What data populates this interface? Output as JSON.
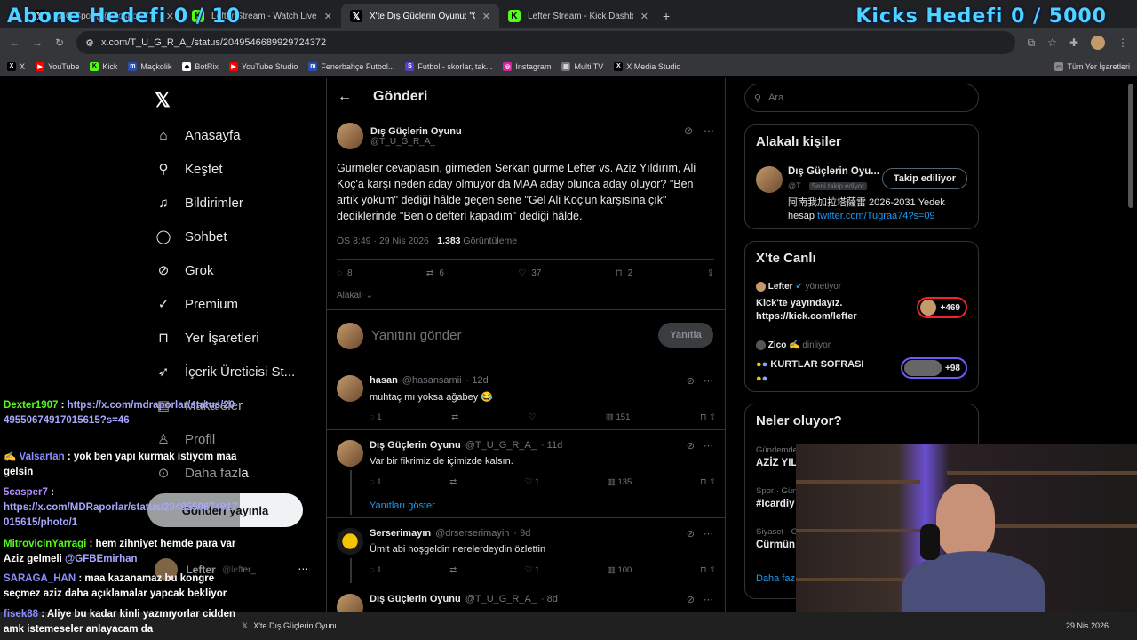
{
  "browser": {
    "tabs": [
      {
        "title": "NEO Spor (@neospor) / X",
        "icon": "x-logo-icon",
        "active": false
      },
      {
        "title": "Lefter Stream - Watch Live on Kick",
        "icon": "kick-icon",
        "active": false
      },
      {
        "title": "X'te Dış Güçlerin Oyunu: \"Gurme",
        "icon": "x-logo-icon",
        "active": true
      },
      {
        "title": "Lefter Stream - Kick Dashboard",
        "icon": "kick-icon",
        "active": false
      }
    ],
    "url": "x.com/T_U_G_R_A_/status/2049546689929724372",
    "bookmarks": [
      {
        "label": "X",
        "icon": "x-logo-icon"
      },
      {
        "label": "YouTube",
        "icon": "youtube-icon"
      },
      {
        "label": "Kick",
        "icon": "kick-icon"
      },
      {
        "label": "Maçkolik",
        "icon": "mackolik-icon"
      },
      {
        "label": "BotRix",
        "icon": "botrix-icon"
      },
      {
        "label": "YouTube Studio",
        "icon": "youtube-icon"
      },
      {
        "label": "Fenerbahçe Futbol...",
        "icon": "folder-m-icon"
      },
      {
        "label": "Futbol - skorlar, tak...",
        "icon": "flashscore-icon"
      },
      {
        "label": "Instagram",
        "icon": "instagram-icon"
      },
      {
        "label": "Multi TV",
        "icon": "page-icon"
      },
      {
        "label": "X Media Studio",
        "icon": "x-logo-icon"
      }
    ],
    "all_bookmarks": "Tüm Yer İşaretleri"
  },
  "overlay": {
    "left": "Abone Hedefi 0 / 10",
    "right": "Kicks Hedefi 0 / 5000"
  },
  "nav": {
    "items": [
      {
        "label": "Anasayfa",
        "icon": "home-icon"
      },
      {
        "label": "Keşfet",
        "icon": "search-icon"
      },
      {
        "label": "Bildirimler",
        "icon": "bell-icon"
      },
      {
        "label": "Sohbet",
        "icon": "chat-icon"
      },
      {
        "label": "Grok",
        "icon": "grok-icon"
      },
      {
        "label": "Premium",
        "icon": "premium-icon"
      },
      {
        "label": "Yer İşaretleri",
        "icon": "bookmark-icon"
      },
      {
        "label": "İçerik Üreticisi St...",
        "icon": "rocket-icon"
      },
      {
        "label": "Makaleler",
        "icon": "article-icon"
      },
      {
        "label": "Profil",
        "icon": "person-icon"
      },
      {
        "label": "Daha fazla",
        "icon": "more-circle-icon"
      }
    ],
    "post_button": "Gönderi yayınla",
    "profile_name": "Lefter",
    "profile_handle": "@lefter_"
  },
  "post": {
    "header": "Gönderi",
    "author_name": "Dış Güçlerin Oyunu",
    "author_handle": "@T_U_G_R_A_",
    "text": "Gurmeler cevaplasın, girmeden Serkan gurme Lefter vs. Aziz Yıldırım, Ali Koç'a karşı neden aday olmuyor da MAA aday olunca aday oluyor? \"Ben artık yokum\" dediği hâlde geçen sene \"Gel Ali Koç'un karşısına çık\" dediklerinde \"Ben o defteri kapadım\" dediği hâlde.",
    "time": "ÖS 8:49 · 29 Nis 2026 · ",
    "views": "1.383",
    "views_label": " Görüntüleme",
    "replies": "8",
    "reposts": "6",
    "likes": "37",
    "bookmarks": "2",
    "related": "Alakalı",
    "reply_placeholder": "Yanıtını gönder",
    "reply_button": "Yanıtla"
  },
  "comments": [
    {
      "name": "hasan",
      "handle": "@hasansamii",
      "time": "· 12d",
      "text": "muhtaç mı yoksa ağabey 😂",
      "replies": "1",
      "reposts": "",
      "likes": "",
      "views": "151"
    },
    {
      "name": "Dış Güçlerin Oyunu",
      "handle": "@T_U_G_R_A_",
      "time": "· 11d",
      "text": "Var bir fikrimiz de içimizde kalsın.",
      "replies": "1",
      "reposts": "",
      "likes": "1",
      "views": "135"
    },
    {
      "name": "Serserimayın",
      "handle": "@drserserimayin",
      "time": "· 9d",
      "text": "Ümit abi hoşgeldin nerelerdeydin özlettin",
      "replies": "1",
      "reposts": "",
      "likes": "1",
      "views": "100"
    },
    {
      "name": "Dış Güçlerin Oyunu",
      "handle": "@T_U_G_R_A_",
      "time": "· 8d",
      "text": "",
      "replies": "",
      "reposts": "",
      "likes": "",
      "views": ""
    }
  ],
  "show_replies": "Yanıtları göster",
  "right": {
    "search_placeholder": "Ara",
    "relevant_title": "Alakalı kişiler",
    "rel_name": "Dış Güçlerin Oyu...",
    "rel_handle": "@T...",
    "rel_badge": "Seni takip ediyor",
    "rel_follow": "Takip ediliyor",
    "rel_bio": "阿南我加拉塔薩雷 2026-2031 Yedek hesap ",
    "rel_link": "twitter.com/Tugraa74?s=09",
    "live_title": "X'te Canlı",
    "live1_host": "Lefter",
    "live1_role": "yönetiyor",
    "live1_title": "Kick'te yayındayız. https://kick.com/lefter",
    "live1_count": "+469",
    "live2_host": "Zico ✍",
    "live2_role": "dinliyor",
    "live2_title": "KURTLAR SOFRASI",
    "live2_count": "+98",
    "trends_title": "Neler oluyor?",
    "trend1_cat": "Gündemdeki",
    "trend1": "AZİZ YIL",
    "trend2_cat": "Spor · Gün",
    "trend2": "#Icardiy",
    "trend3_cat": "Siyaset · G",
    "trend3": "Cürmün",
    "more": "Daha faz"
  },
  "chat": [
    {
      "user": "Dexter1907",
      "msg": "",
      "link": "https://x.com/mdraporlar/status/2049550674917015615?s=46",
      "color": "#53fc18"
    },
    {
      "user": "Valsartan",
      "msg": "yok ben yapı kurmak istiyom maa gelsin",
      "link": "",
      "color": "#8a8dff"
    },
    {
      "user": "5casper7",
      "msg": "",
      "link": "https://x.com/MDRaporlar/status/2049550674917015615/photo/1",
      "color": "#b38cff"
    },
    {
      "user": "MitrovicinYarragi",
      "msg": "hem zihniyet hemde para var Aziz gelmeli ",
      "mention": "@GFBEmirhan",
      "color": "#53fc18"
    },
    {
      "user": "SARAGA_HAN",
      "msg": "maa kazanamaz bu kongre seçmez aziz daha açıklamalar yapcak bekliyor",
      "link": "",
      "color": "#8a8dff"
    },
    {
      "user": "fisek88",
      "msg": "Aliye bu kadar kinli yazmıyorlar cidden amk istemeseler anlayacam da",
      "link": "",
      "color": "#8a8dff"
    }
  ],
  "taskbar": {
    "date": "29 Nis 2026",
    "app": "X'te Dış Güçlerin Oyunu"
  }
}
